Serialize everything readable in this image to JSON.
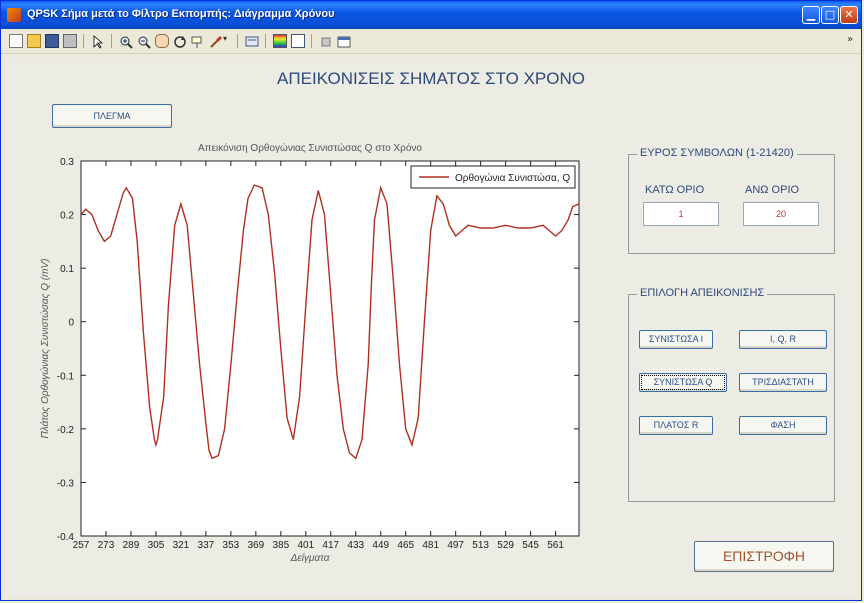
{
  "window": {
    "title": "QPSK Σήμα μετά το Φίλτρο Εκπομπής: Διάγραμμα Χρόνου",
    "minimize": "▁",
    "maximize": "□",
    "close": "✕",
    "menu_arrow": "»"
  },
  "toolbar": {
    "icons": [
      "new-file-icon",
      "open-file-icon",
      "save-icon",
      "print-icon",
      "pointer-icon",
      "zoom-in-icon",
      "zoom-out-icon",
      "pan-icon",
      "rotate-icon",
      "data-cursor-icon",
      "brush-icon",
      "link-icon",
      "colorbar-icon",
      "legend-icon",
      "hide-plot-tools-icon",
      "show-plot-tools-icon"
    ]
  },
  "page": {
    "title": "ΑΠΕΙΚΟΝΙΣΕΙΣ ΣΗΜΑΤΟΣ ΣΤΟ ΧΡΟΝΟ",
    "grid_button": "ΠΛΕΓΜΑ",
    "back_button": "ΕΠΙΣΤΡΟΦΗ"
  },
  "range_panel": {
    "title": "ΕΥΡΟΣ ΣΥΜΒΟΛΩΝ (1-21420)",
    "lower_label": "ΚΑΤΩ ΟΡΙΟ",
    "upper_label": "ΑΝΩ ΟΡΙΟ",
    "lower_value": "1",
    "upper_value": "20"
  },
  "display_panel": {
    "title": "ΕΠΙΛΟΓΗ ΑΠΕΙΚΟΝΙΣΗΣ",
    "buttons": [
      "ΣΥΝΙΣΤΩΣΑ Ι",
      "Ι, Q, R",
      "ΣΥΝΙΣΤΩΣΑ Q",
      "ΤΡΙΣΔΙΑΣΤΑΤΗ",
      "ΠΛΑΤΟΣ R",
      "ΦΑΣΗ"
    ]
  },
  "colors": {
    "line": "#b03020",
    "accent_text": "#2e4a7a"
  },
  "chart_data": {
    "type": "line",
    "title": "Απεικόνιση Ορθογώνιας Συνιστώσας Q στο Χρόνο",
    "xlabel": "Δείγματα",
    "ylabel": "Πλάτος Ορθογώνιας Συνιστώσας Q (mV)",
    "xlim": [
      257,
      576
    ],
    "ylim": [
      -0.4,
      0.3
    ],
    "xticks": [
      257,
      273,
      289,
      305,
      321,
      337,
      353,
      369,
      385,
      401,
      417,
      433,
      449,
      465,
      481,
      497,
      513,
      529,
      545,
      561
    ],
    "xtick_labels": [
      "257",
      "273",
      "289",
      "305",
      "321",
      "337",
      "353",
      "369",
      "385",
      "401",
      "417",
      "433",
      "449",
      "465",
      "481",
      "497",
      "513",
      "529",
      "545",
      "561"
    ],
    "yticks": [
      -0.4,
      -0.3,
      -0.2,
      -0.1,
      0,
      0.1,
      0.2,
      0.3
    ],
    "ytick_labels": [
      "-0.4",
      "-0.3",
      "-0.2",
      "-0.1",
      "0",
      "0.1",
      "0.2",
      "0.3"
    ],
    "grid": false,
    "legend": "top-right",
    "series": [
      {
        "name": "Ορθογώνια Συνιστώσα, Q",
        "x": [
          257,
          260,
          264,
          268,
          272,
          276,
          280,
          284,
          286,
          290,
          293,
          297,
          301,
          304,
          305,
          306,
          310,
          313,
          317,
          321,
          325,
          329,
          333,
          337,
          339,
          341,
          345,
          349,
          353,
          357,
          361,
          364,
          368,
          373,
          377,
          381,
          385,
          389,
          393,
          397,
          401,
          405,
          409,
          413,
          417,
          421,
          425,
          429,
          433,
          437,
          441,
          443,
          445,
          449,
          453,
          457,
          461,
          465,
          469,
          473,
          477,
          481,
          485,
          489,
          493,
          497,
          501,
          505,
          513,
          521,
          529,
          537,
          545,
          553,
          557,
          561,
          565,
          569,
          572,
          576
        ],
        "y": [
          0.2,
          0.21,
          0.2,
          0.17,
          0.15,
          0.16,
          0.2,
          0.24,
          0.25,
          0.23,
          0.15,
          -0.02,
          -0.16,
          -0.22,
          -0.23,
          -0.22,
          -0.14,
          0.03,
          0.18,
          0.22,
          0.18,
          0.05,
          -0.08,
          -0.19,
          -0.24,
          -0.255,
          -0.25,
          -0.2,
          -0.08,
          0.05,
          0.17,
          0.23,
          0.255,
          0.25,
          0.2,
          0.09,
          -0.05,
          -0.18,
          -0.22,
          -0.14,
          0.03,
          0.19,
          0.245,
          0.2,
          0.05,
          -0.1,
          -0.2,
          -0.245,
          -0.255,
          -0.22,
          -0.08,
          0.07,
          0.19,
          0.25,
          0.22,
          0.08,
          -0.08,
          -0.2,
          -0.23,
          -0.18,
          0.0,
          0.17,
          0.235,
          0.22,
          0.18,
          0.16,
          0.17,
          0.18,
          0.175,
          0.175,
          0.18,
          0.175,
          0.175,
          0.18,
          0.17,
          0.16,
          0.17,
          0.19,
          0.215,
          0.22
        ]
      }
    ]
  }
}
